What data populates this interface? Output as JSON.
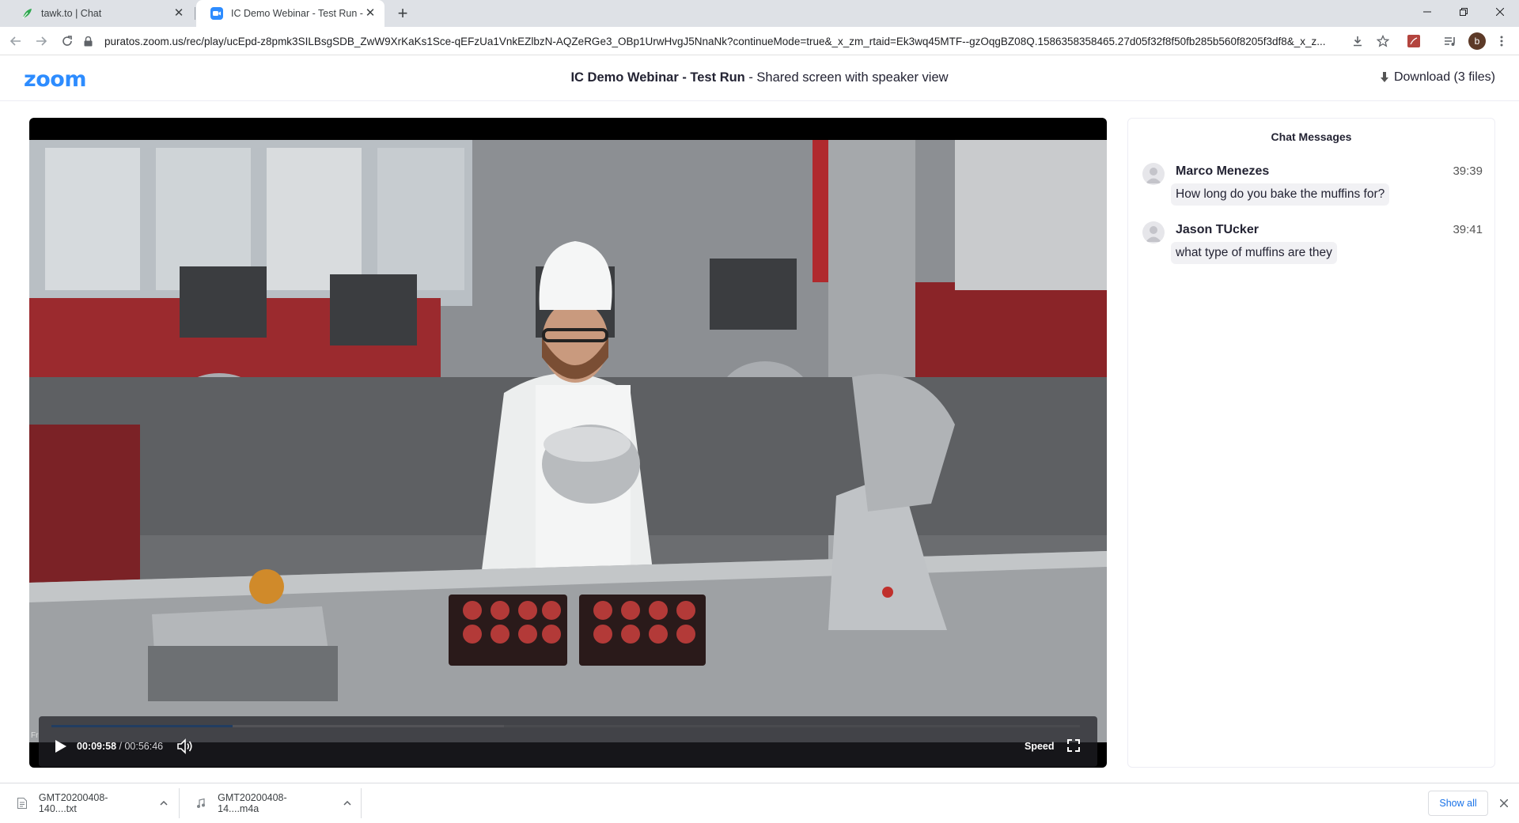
{
  "browser": {
    "tabs": [
      {
        "title": "tawk.to | Chat",
        "icon": "tawk-leaf-icon",
        "active": false
      },
      {
        "title": "IC Demo Webinar - Test Run - Zo",
        "icon": "zoom-video-icon",
        "active": true
      }
    ],
    "url": "puratos.zoom.us/rec/play/ucEpd-z8pmk3SILBsgSDB_ZwW9XrKaKs1Sce-qEFzUa1VnkEZlbzN-AQZeRGe3_OBp1UrwHvgJ5NnaNk?continueMode=true&_x_zm_rtaid=Ek3wq45MTF--gzOqgBZ08Q.1586358358465.27d05f32f8f50fb285b560f8205f3df8&_x_z...",
    "profile_initial": "b"
  },
  "zoom": {
    "logo": "zoom",
    "title_bold": "IC Demo Webinar - Test Run",
    "title_rest": " - Shared screen with speaker view",
    "download_label": "Download (3 files)"
  },
  "player": {
    "current_time": "00:09:58",
    "separator": " / ",
    "total_time": "00:56:46",
    "progress": 0.176,
    "buffered": 0.44,
    "speed_label": "Speed",
    "corner_text": "Fr"
  },
  "chat": {
    "title": "Chat Messages",
    "messages": [
      {
        "name": "Marco Menezes",
        "time": "39:39",
        "text": "How long do you bake the muffins for?"
      },
      {
        "name": "Jason TUcker",
        "time": "39:41",
        "text": "what type of muffins are they"
      }
    ]
  },
  "downloads": {
    "items": [
      {
        "name": "GMT20200408-140....txt",
        "icon": "text-file-icon"
      },
      {
        "name": "GMT20200408-14....m4a",
        "icon": "audio-file-icon"
      }
    ],
    "show_all": "Show all"
  },
  "colors": {
    "zoom_blue": "#2d8cff",
    "chrome_tabbar": "#dee1e6",
    "video_bg": "#000000"
  }
}
